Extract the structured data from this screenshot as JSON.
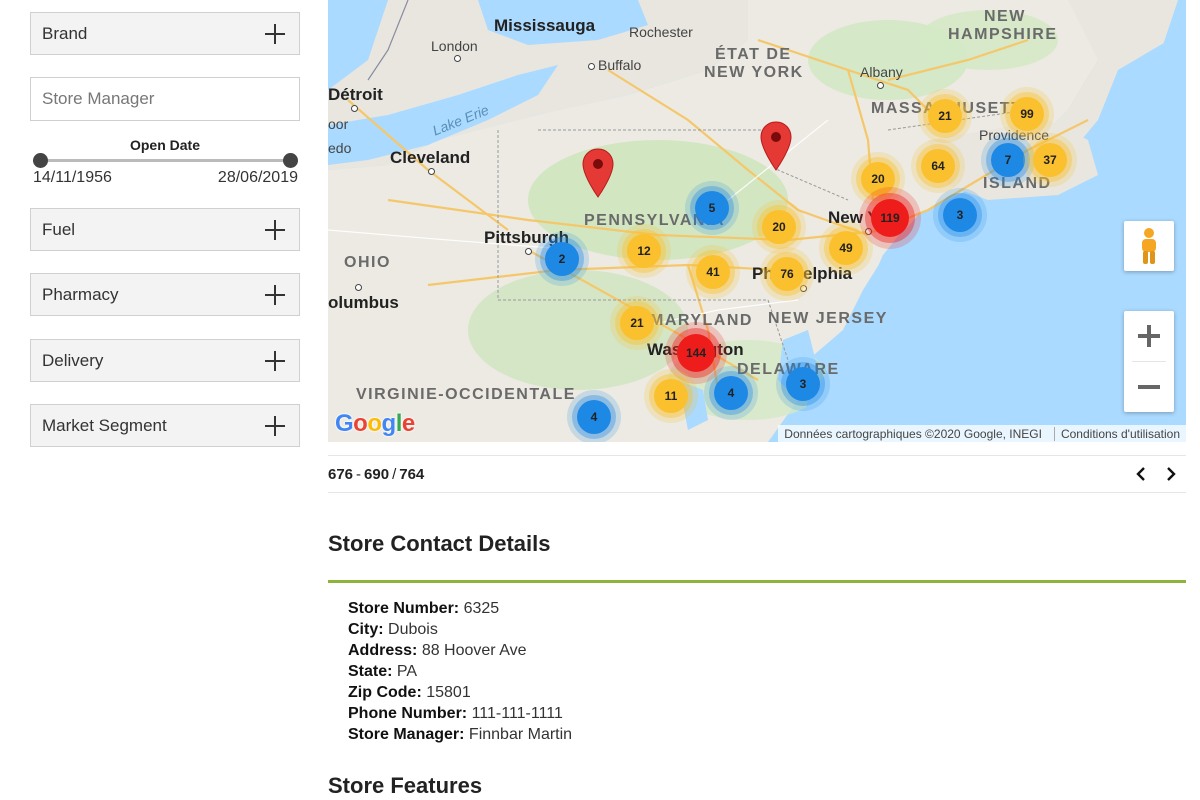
{
  "sidebar": {
    "filters": {
      "brand": "Brand",
      "fuel": "Fuel",
      "pharmacy": "Pharmacy",
      "delivery": "Delivery",
      "market_segment": "Market Segment"
    },
    "store_manager_placeholder": "Store Manager",
    "open_date": {
      "title": "Open Date",
      "min": "14/11/1956",
      "max": "28/06/2019"
    }
  },
  "map": {
    "labels": {
      "mississauga": "Mississauga",
      "rochester": "Rochester",
      "london": "London",
      "buffalo": "Buffalo",
      "etat_de": "ÉTAT DE",
      "new_york_state": "NEW YORK",
      "albany": "Albany",
      "new": "NEW",
      "hampshire": "HAMPSHIRE",
      "detroit": "Détroit",
      "lake_erie": "Lake Erie",
      "cleveland": "Cleveland",
      "massachusetts": "MASSACHUSETTS",
      "providence": "Providence",
      "island": "ISLAND",
      "pennsylvania": "PENNSYLVANIA",
      "pittsburgh": "Pittsburgh",
      "new_york_city": "New York",
      "ohio": "OHIO",
      "philadelphia": "Philadelphia",
      "columbus": "olumbus",
      "maryland": "MARYLAND",
      "new_jersey": "NEW JERSEY",
      "washington": "Washington",
      "delaware": "DELAWARE",
      "virginie_occidentale": "VIRGINIE-OCCIDENTALE",
      "toledo_partial": "oor",
      "edo_partial": "edo"
    },
    "clusters": [
      {
        "count": "21",
        "color": "yellow"
      },
      {
        "count": "99",
        "color": "yellow"
      },
      {
        "count": "64",
        "color": "yellow"
      },
      {
        "count": "7",
        "color": "blue"
      },
      {
        "count": "37",
        "color": "yellow"
      },
      {
        "count": "20",
        "color": "yellow"
      },
      {
        "count": "5",
        "color": "blue"
      },
      {
        "count": "119",
        "color": "red"
      },
      {
        "count": "3",
        "color": "blue"
      },
      {
        "count": "20",
        "color": "yellow"
      },
      {
        "count": "12",
        "color": "yellow"
      },
      {
        "count": "49",
        "color": "yellow"
      },
      {
        "count": "2",
        "color": "blue"
      },
      {
        "count": "41",
        "color": "yellow"
      },
      {
        "count": "76",
        "color": "yellow"
      },
      {
        "count": "21",
        "color": "yellow"
      },
      {
        "count": "144",
        "color": "red"
      },
      {
        "count": "3",
        "color": "blue"
      },
      {
        "count": "4",
        "color": "blue"
      },
      {
        "count": "11",
        "color": "yellow"
      },
      {
        "count": "4",
        "color": "blue"
      }
    ],
    "attribution": "Données cartographiques ©2020 Google, INEGI",
    "terms": "Conditions d'utilisation",
    "logo": "Google"
  },
  "pagination": {
    "start": "676",
    "end": "690",
    "total": "764"
  },
  "store_contact": {
    "title": "Store Contact Details",
    "fields": [
      {
        "label": "Store Number:",
        "value": "6325"
      },
      {
        "label": "City:",
        "value": "Dubois"
      },
      {
        "label": "Address:",
        "value": "88 Hoover Ave"
      },
      {
        "label": "State:",
        "value": "PA"
      },
      {
        "label": "Zip Code:",
        "value": "15801"
      },
      {
        "label": "Phone Number:",
        "value": "111-111-1111"
      },
      {
        "label": "Store Manager:",
        "value": "Finnbar Martin"
      }
    ]
  },
  "store_features": {
    "title": "Store Features"
  },
  "colors": {
    "accent_green": "#8db33a",
    "cluster_blue": "#1e88e5",
    "cluster_yellow": "#fbc02d",
    "cluster_red": "#ef1c1c",
    "pin_red": "#e53935"
  }
}
